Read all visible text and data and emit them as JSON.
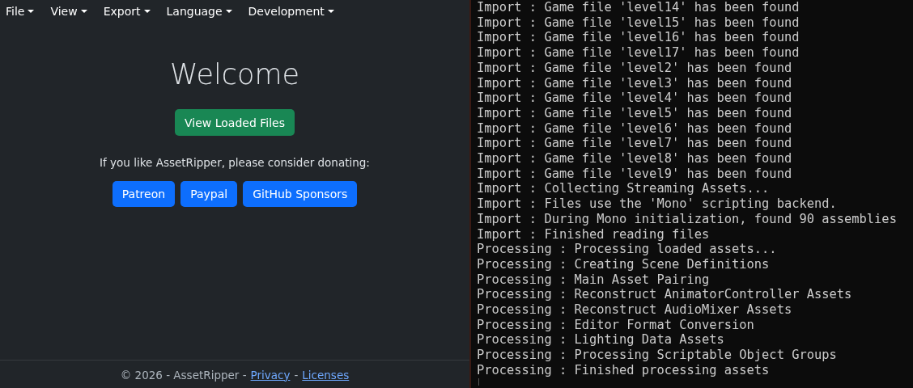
{
  "menu": [
    {
      "label": "File"
    },
    {
      "label": "View"
    },
    {
      "label": "Export"
    },
    {
      "label": "Language"
    },
    {
      "label": "Development"
    }
  ],
  "welcome": {
    "title": "Welcome",
    "primary_button": "View Loaded Files",
    "donate_text": "If you like AssetRipper, please consider donating:",
    "donate_buttons": [
      "Patreon",
      "Paypal",
      "GitHub Sponsors"
    ]
  },
  "footer": {
    "copyright": "© 2026 - AssetRipper -",
    "links": [
      "Privacy",
      "Licenses"
    ],
    "separator": "-"
  },
  "console": {
    "lines": [
      "Import : Game file 'level14' has been found",
      "Import : Game file 'level15' has been found",
      "Import : Game file 'level16' has been found",
      "Import : Game file 'level17' has been found",
      "Import : Game file 'level2' has been found",
      "Import : Game file 'level3' has been found",
      "Import : Game file 'level4' has been found",
      "Import : Game file 'level5' has been found",
      "Import : Game file 'level6' has been found",
      "Import : Game file 'level7' has been found",
      "Import : Game file 'level8' has been found",
      "Import : Game file 'level9' has been found",
      "Import : Collecting Streaming Assets...",
      "Import : Files use the 'Mono' scripting backend.",
      "Import : During Mono initialization, found 90 assemblies",
      "Import : Finished reading files",
      "Processing : Processing loaded assets...",
      "Processing : Creating Scene Definitions",
      "Processing : Main Asset Pairing",
      "Processing : Reconstruct AnimatorController Assets",
      "Processing : Reconstruct AudioMixer Assets",
      "Processing : Editor Format Conversion",
      "Processing : Lighting Data Assets",
      "Processing : Processing Scriptable Object Groups",
      "Processing : Finished processing assets"
    ]
  }
}
